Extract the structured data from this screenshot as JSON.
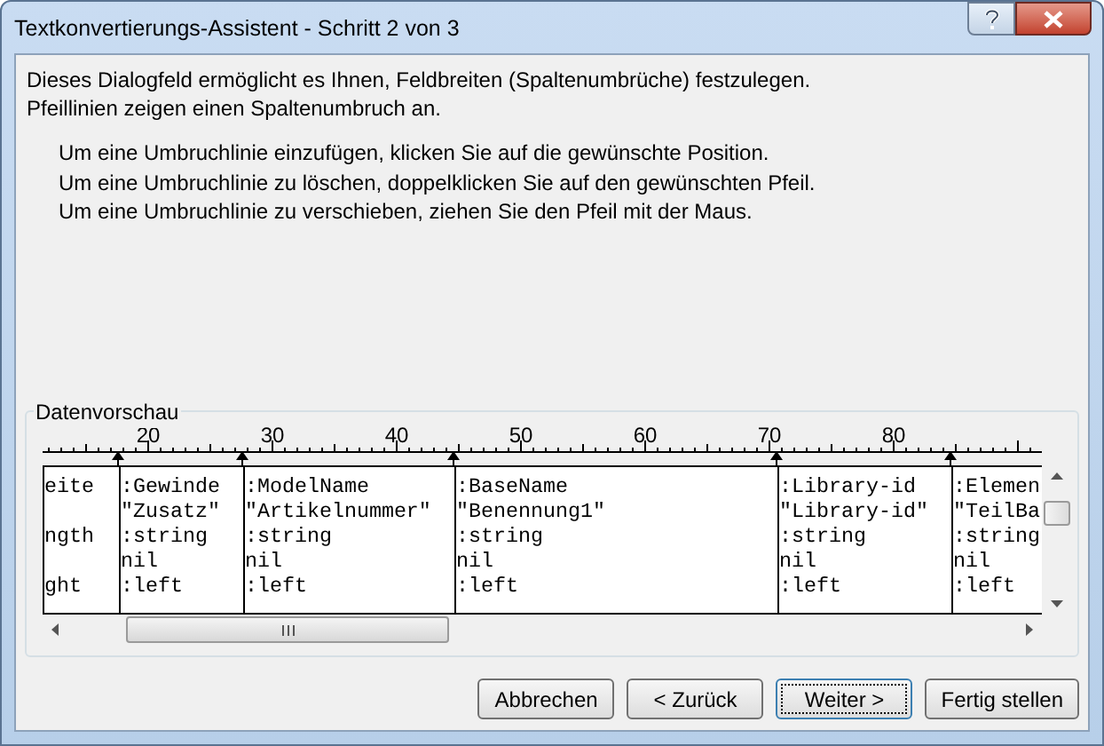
{
  "window": {
    "title": "Textkonvertierungs-Assistent - Schritt 2 von 3"
  },
  "intro": [
    "Dieses Dialogfeld ermöglicht es Ihnen, Feldbreiten (Spaltenumbrüche) festzulegen.",
    "Pfeillinien zeigen einen Spaltenumbruch an."
  ],
  "instructions": [
    "Um eine Umbruchlinie einzufügen, klicken Sie auf die gewünschte Position.",
    "Um eine Umbruchlinie zu löschen, doppelklicken Sie auf den gewünschten Pfeil.",
    "Um eine Umbruchlinie zu verschieben, ziehen Sie den Pfeil mit der Maus."
  ],
  "preview": {
    "label": "Datenvorschau",
    "ruler": [
      "20",
      "30",
      "40",
      "50",
      "60",
      "70",
      "80"
    ],
    "columns": [
      {
        "lines": [
          {
            "kind": "text",
            "text": "eite"
          },
          {
            "kind": "blank"
          },
          {
            "kind": "text",
            "text": "ngth"
          },
          {
            "kind": "blank"
          },
          {
            "kind": "text",
            "text": "ght"
          }
        ]
      },
      {
        "lines": [
          ":Gewinde",
          "\"Zusatz\"",
          ":string",
          "nil",
          ":left"
        ]
      },
      {
        "lines": [
          ":ModelName",
          "\"Artikelnummer\"",
          ":string",
          "nil",
          ":left"
        ]
      },
      {
        "lines": [
          ":BaseName",
          "\"Benennung1\"",
          ":string",
          "nil",
          ":left"
        ]
      },
      {
        "lines": [
          ":Library-id",
          "\"Library-id\"",
          ":string",
          "nil",
          ":left"
        ]
      },
      {
        "lines": [
          ":Elemen",
          "\"TeilBa",
          ":string",
          "nil",
          ":left"
        ]
      }
    ]
  },
  "buttons": [
    {
      "label": "Abbrechen",
      "default": false
    },
    {
      "label": "< Zurück",
      "default": false
    },
    {
      "label": "Weiter >",
      "default": true
    },
    {
      "label": "Fertig stellen",
      "default": false
    }
  ]
}
